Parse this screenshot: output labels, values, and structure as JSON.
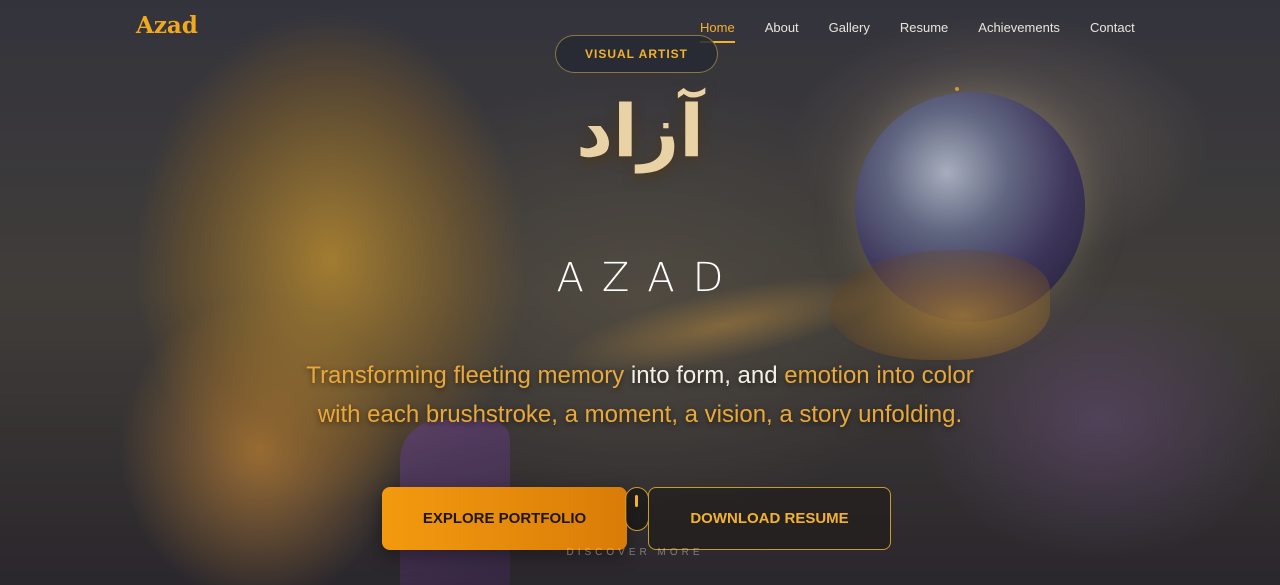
{
  "brand": {
    "logo": "Azad"
  },
  "nav": {
    "items": [
      {
        "label": "Home",
        "active": true
      },
      {
        "label": "About",
        "active": false
      },
      {
        "label": "Gallery",
        "active": false
      },
      {
        "label": "Resume",
        "active": false
      },
      {
        "label": "Achievements",
        "active": false
      },
      {
        "label": "Contact",
        "active": false
      }
    ]
  },
  "hero": {
    "badge": "VISUAL ARTIST",
    "arabic_name": "آزاد",
    "name": "AZAD",
    "tagline": {
      "part1": "Transforming fleeting memory",
      "part2": " into form, and ",
      "part3": "emotion into color",
      "line2": "with each brushstroke, a moment, a vision, a story unfolding."
    },
    "primary_button": "EXPLORE PORTFOLIO",
    "secondary_button": "DOWNLOAD RESUME",
    "scroll_hint": "DISCOVER MORE"
  },
  "colors": {
    "accent": "#f2b230",
    "button_primary": "#f39a0f",
    "background": "#2b2a33"
  },
  "icons": {
    "scroll": "mouse-scroll-icon"
  }
}
